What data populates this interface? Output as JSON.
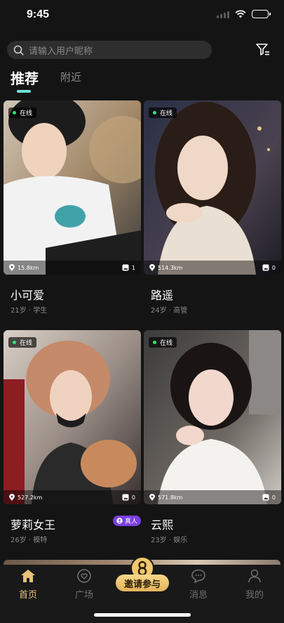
{
  "status_bar": {
    "time": "9:45"
  },
  "search": {
    "placeholder": "请输入用户昵称"
  },
  "tabs": [
    {
      "label": "推荐",
      "active": true
    },
    {
      "label": "附近",
      "active": false
    }
  ],
  "cards": [
    {
      "name": "小可爱",
      "meta": "21岁 · 学生",
      "status": "在线",
      "distance": "15.8km",
      "photo_count": "1",
      "verified": false
    },
    {
      "name": "路遥",
      "meta": "24岁 · 高管",
      "status": "在线",
      "distance": "514.3km",
      "photo_count": "0",
      "verified": false
    },
    {
      "name": "萝莉女王",
      "meta": "26岁 · 模特",
      "status": "在线",
      "distance": "527.2km",
      "photo_count": "0",
      "verified": true,
      "verified_label": "真人"
    },
    {
      "name": "云熙",
      "meta": "23岁 · 娱乐",
      "status": "在线",
      "distance": "571.8km",
      "photo_count": "0",
      "verified": false
    }
  ],
  "bottom_nav": {
    "home": "首页",
    "square": "广场",
    "invite": "邀请参与",
    "messages": "消息",
    "mine": "我的"
  },
  "colors": {
    "background": "#141414",
    "accent_tab": "#6ee0d7",
    "online_dot": "#2ee572",
    "nav_active": "#e8c27a",
    "verified_badge": "#7a3fe0",
    "invite_gold": "#f0c76c"
  }
}
